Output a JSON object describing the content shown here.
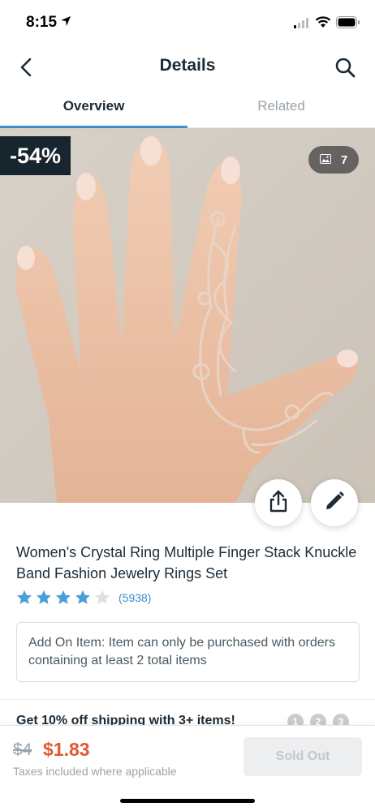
{
  "status_bar": {
    "time": "8:15",
    "icons": [
      "location-arrow-icon",
      "cellular-signal-icon",
      "wifi-icon",
      "battery-icon"
    ]
  },
  "nav": {
    "title": "Details",
    "back_icon": "chevron-left-icon",
    "search_icon": "search-icon"
  },
  "tabs": [
    {
      "label": "Overview",
      "active": true
    },
    {
      "label": "Related",
      "active": false
    }
  ],
  "product": {
    "discount_badge": "-54%",
    "photo_count": "7",
    "title": "Women's Crystal Ring Multiple Finger Stack Knuckle Band Fashion Jewelry Rings Set",
    "rating": 4,
    "rating_max": 5,
    "rating_count": "(5938)",
    "notice": "Add On Item: Item can only be purchased with orders containing at least 2 total items"
  },
  "promo": {
    "text": "Get 10% off shipping with 3+ items!",
    "steps": [
      "1",
      "2",
      "3"
    ]
  },
  "purchase": {
    "old_price": "$4",
    "new_price": "$1.83",
    "tax_note": "Taxes included where applicable",
    "button_label": "Sold Out"
  },
  "colors": {
    "accent": "#3d8ec4",
    "price": "#e4572e",
    "badge_bg": "#16252e",
    "star": "#4a9fd8"
  }
}
